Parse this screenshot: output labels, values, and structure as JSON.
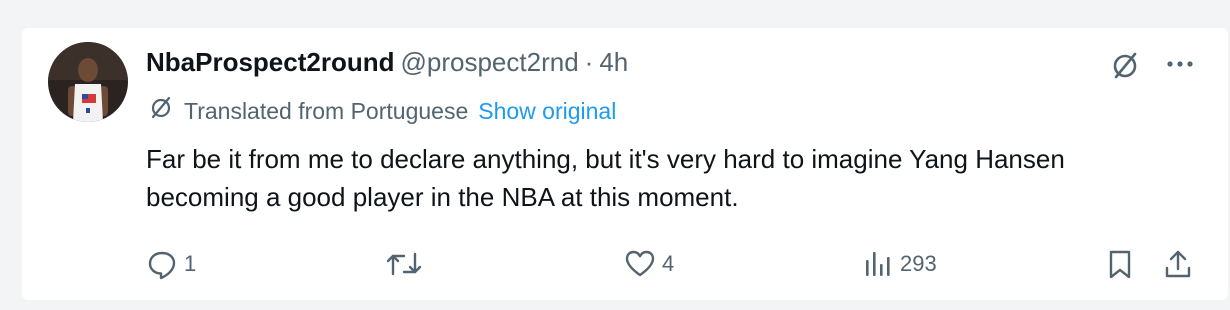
{
  "tweet": {
    "display_name": "NbaProspect2round",
    "handle": "@prospect2rnd",
    "separator": "·",
    "time": "4h",
    "translated_label": "Translated from Portuguese",
    "show_original": "Show original",
    "text": "Far be it from me to declare anything, but it's very hard to imagine Yang Hansen becoming a good player in the NBA at this moment."
  },
  "actions": {
    "replies": "1",
    "reposts": "",
    "likes": "4",
    "views": "293"
  },
  "icons": {
    "grok": "grok-slash-icon",
    "more": "more-icon",
    "reply": "reply-icon",
    "repost": "repost-icon",
    "like": "heart-icon",
    "views": "views-icon",
    "bookmark": "bookmark-icon",
    "share": "share-icon"
  },
  "colors": {
    "text": "#0f1419",
    "secondary": "#536471",
    "link": "#1d9bf0"
  }
}
